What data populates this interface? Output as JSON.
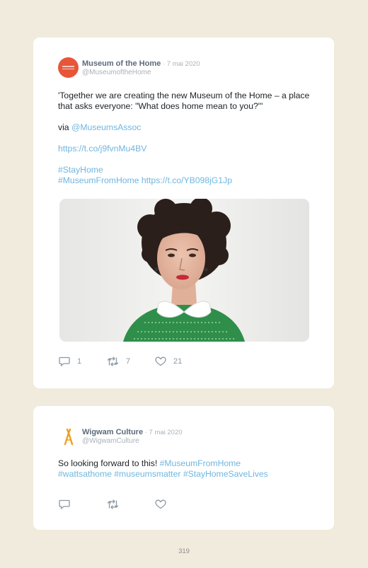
{
  "tweets": [
    {
      "display_name": "Museum of the Home",
      "date": "7 mai 2020",
      "handle": "@MuseumoftheHome",
      "text_line1": "'Together we are creating the new Museum of the Home – a place that asks everyone: \"What does home mean to you?\"'",
      "via_prefix": "via ",
      "via_link": "@MuseumsAssoc",
      "link1": "https://t.co/j9fvnMu4BV",
      "hashtag1": "#StayHome",
      "hashtag2": "#MuseumFromHome",
      "link2": "https://t.co/YB098jG1Jp",
      "replies": "1",
      "retweets": "7",
      "likes": "21",
      "avatar_icon": "museum-of-the-home-logo-icon",
      "image": "portrait-photo"
    },
    {
      "display_name": "Wigwam Culture",
      "date": "7 mai 2020",
      "handle": "@WigwamCulture",
      "text_plain": "So looking forward to this! ",
      "hashtag1": "#MuseumFromHome",
      "hashtag2": "#wattsathome",
      "hashtag3": "#museumsmatter",
      "hashtag4": "#StayHomeSaveLives",
      "replies": "",
      "retweets": "",
      "likes": "",
      "avatar_icon": "wigwam-logo-icon"
    }
  ],
  "separator": " · ",
  "page_number": "319",
  "colors": {
    "background": "#f0ebdc",
    "link": "#6fb6e0",
    "museum_avatar": "#e8553a",
    "wigwam_logo": "#f0a020"
  }
}
